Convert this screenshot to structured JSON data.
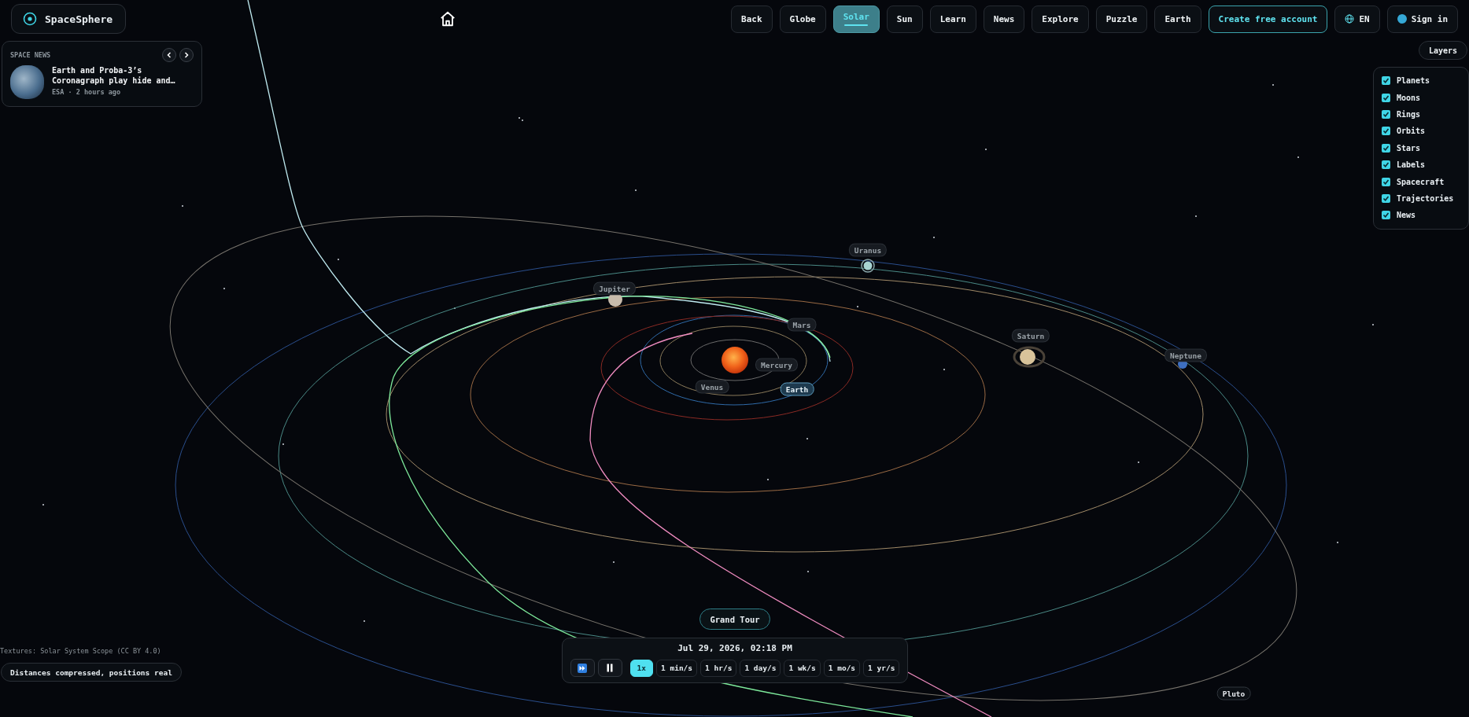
{
  "logo": {
    "text": "SpaceSphere"
  },
  "nav": [
    {
      "label": "Back",
      "selected": false
    },
    {
      "label": "Globe",
      "selected": false
    },
    {
      "label": "Solar",
      "selected": true
    },
    {
      "label": "Sun",
      "selected": false
    },
    {
      "label": "Learn",
      "selected": false
    },
    {
      "label": "News",
      "selected": false
    },
    {
      "label": "Explore",
      "selected": false
    },
    {
      "label": "Puzzle",
      "selected": false
    },
    {
      "label": "Earth",
      "selected": false
    }
  ],
  "create_account": "Create free account",
  "language": "EN",
  "sign_in": "Sign in",
  "layers": {
    "button": "Layers",
    "items": [
      {
        "label": "Planets",
        "checked": true
      },
      {
        "label": "Moons",
        "checked": true
      },
      {
        "label": "Rings",
        "checked": true
      },
      {
        "label": "Orbits",
        "checked": true
      },
      {
        "label": "Stars",
        "checked": true
      },
      {
        "label": "Labels",
        "checked": true
      },
      {
        "label": "Spacecraft",
        "checked": true
      },
      {
        "label": "Trajectories",
        "checked": true
      },
      {
        "label": "News",
        "checked": true
      }
    ]
  },
  "news": {
    "heading": "SPACE NEWS",
    "title": "Earth and Proba-3’s Coronagraph play hide and…",
    "meta": "ESA · 2 hours ago"
  },
  "planets": [
    {
      "label": "Uranus",
      "selected": false
    },
    {
      "label": "Jupiter",
      "selected": false
    },
    {
      "label": "Mars",
      "selected": false
    },
    {
      "label": "Saturn",
      "selected": false
    },
    {
      "label": "Neptune",
      "selected": false
    },
    {
      "label": "Mercury",
      "selected": false
    },
    {
      "label": "Venus",
      "selected": false
    },
    {
      "label": "Earth",
      "selected": true
    },
    {
      "label": "Pluto",
      "selected": false
    }
  ],
  "grand_tour": "Grand Tour",
  "time": {
    "datetime": "Jul 29, 2026, 02:18 PM",
    "speeds": [
      {
        "label": "1x",
        "selected": true
      },
      {
        "label": "1 min/s",
        "selected": false
      },
      {
        "label": "1 hr/s",
        "selected": false
      },
      {
        "label": "1 day/s",
        "selected": false
      },
      {
        "label": "1 wk/s",
        "selected": false
      },
      {
        "label": "1 mo/s",
        "selected": false
      },
      {
        "label": "1 yr/s",
        "selected": false
      }
    ]
  },
  "credit": "Textures: Solar System Scope (CC BY 4.0)",
  "note": "Distances compressed, positions real"
}
